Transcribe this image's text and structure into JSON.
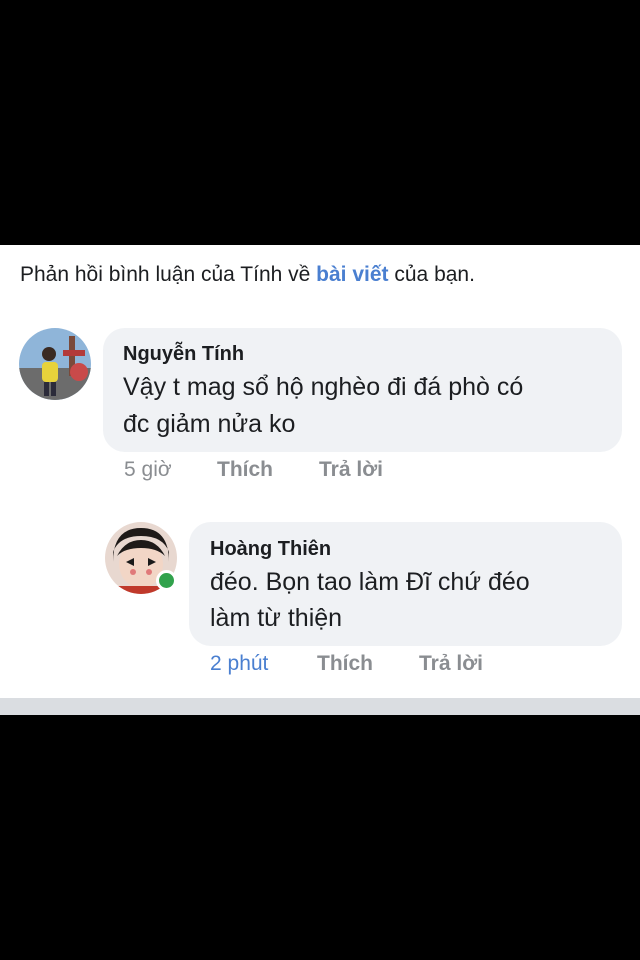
{
  "notification": {
    "prefix": "Phản hồi bình luận của Tính về ",
    "link_text": "bài viết",
    "suffix": " của bạn."
  },
  "comments": [
    {
      "author": "Nguyễn Tính",
      "lines": [
        "Vậy t mag sổ hộ nghèo đi đá phò có",
        "đc giảm nửa ko"
      ],
      "time": "5 giờ",
      "like_label": "Thích",
      "reply_label": "Trả lời"
    },
    {
      "author": "Hoàng Thiên",
      "lines": [
        "đéo. Bọn tao làm Đĩ chứ đéo",
        "làm từ thiện"
      ],
      "time": "2 phút",
      "like_label": "Thích",
      "reply_label": "Trả lời",
      "online": true
    }
  ],
  "colors": {
    "link": "#4a7fd0",
    "bubble": "#f0f2f5",
    "presence": "#31a24c",
    "muted": "#8a8d91"
  }
}
